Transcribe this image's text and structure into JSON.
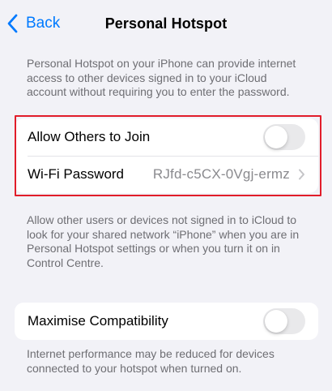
{
  "nav": {
    "back_label": "Back",
    "title": "Personal Hotspot"
  },
  "intro_text": "Personal Hotspot on your iPhone can provide internet access to other devices signed in to your iCloud account without requiring you to enter the password.",
  "sharing": {
    "allow_label": "Allow Others to Join",
    "allow_on": false,
    "wifi_label": "Wi-Fi Password",
    "wifi_value": "RJfd-c5CX-0Vgj-ermz"
  },
  "sharing_footer": "Allow other users or devices not signed in to iCloud to look for your shared network “iPhone” when you are in Personal Hotspot settings or when you turn it on in Control Centre.",
  "compat": {
    "label": "Maximise Compatibility",
    "on": false
  },
  "compat_footer": "Internet performance may be reduced for devices connected to your hotspot when turned on.",
  "colors": {
    "accent": "#007aff",
    "background": "#f2f2f7",
    "highlight": "#e11d2a",
    "toggle_off": "#e9e9eb"
  },
  "icons": {
    "back": "chevron-left-icon",
    "disclosure": "chevron-right-icon"
  }
}
